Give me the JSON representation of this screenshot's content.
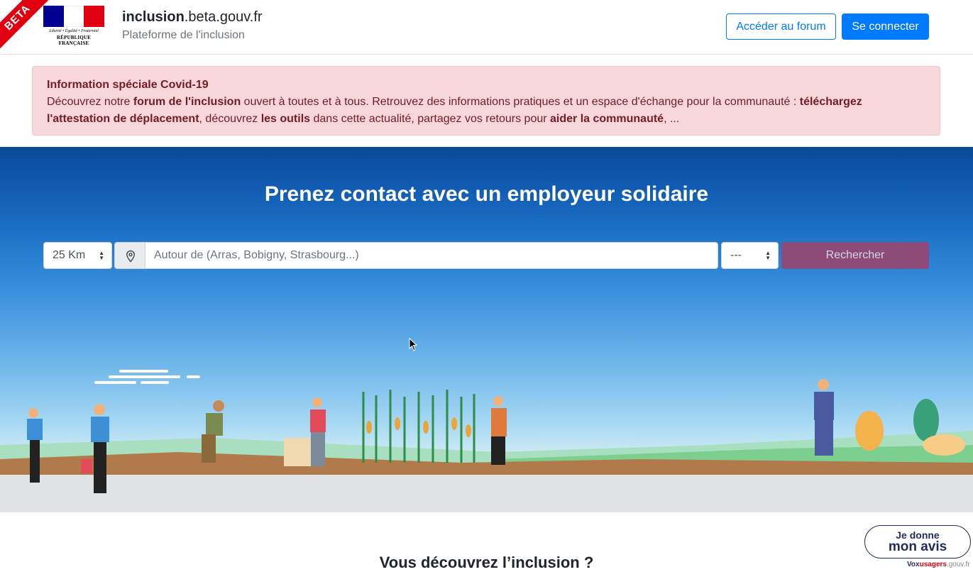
{
  "header": {
    "beta_label": "BETA",
    "logo": {
      "motto": "Liberté • Égalité • Fraternité",
      "republic": "RÉPUBLIQUE FRANÇAISE",
      "flag_colors": [
        "#000091",
        "#ffffff",
        "#e1000f"
      ]
    },
    "site_name_bold": "inclusion",
    "site_name_rest": ".beta.gouv.fr",
    "subtitle": "Plateforme de l'inclusion",
    "forum_button": "Accéder au forum",
    "login_button": "Se connecter"
  },
  "alert": {
    "title": "Information spéciale Covid-19",
    "t1": "Découvrez notre ",
    "b1": "forum de l'inclusion",
    "t2": " ouvert à toutes et à tous. Retrouvez des informations pratiques et un espace d'échange pour la communauté : ",
    "b2": "téléchargez l'attestation de déplacement",
    "t3": ", découvrez ",
    "b3": "les outils",
    "t4": " dans cette actualité, partagez vos retours pour ",
    "b4": "aider la communauté",
    "t5": ", ..."
  },
  "hero": {
    "title": "Prenez contact avec un employeur solidaire",
    "distance_select": "25 Km",
    "location_placeholder": "Autour de (Arras, Bobigny, Strasbourg...)",
    "kind_select": "---",
    "search_button": "Rechercher"
  },
  "section": {
    "discover_title": "Vous découvrez l’inclusion ?"
  },
  "feedback": {
    "line1": "Je donne",
    "line2": "mon avis",
    "brand_a": "Vox",
    "brand_b": "usagers",
    "brand_c": ".gouv.fr"
  },
  "colors": {
    "primary": "#007bff",
    "alert_bg": "#f8d7da",
    "alert_text": "#721c24",
    "search_button": "#8e4a78",
    "beta_red": "#e1000f"
  }
}
